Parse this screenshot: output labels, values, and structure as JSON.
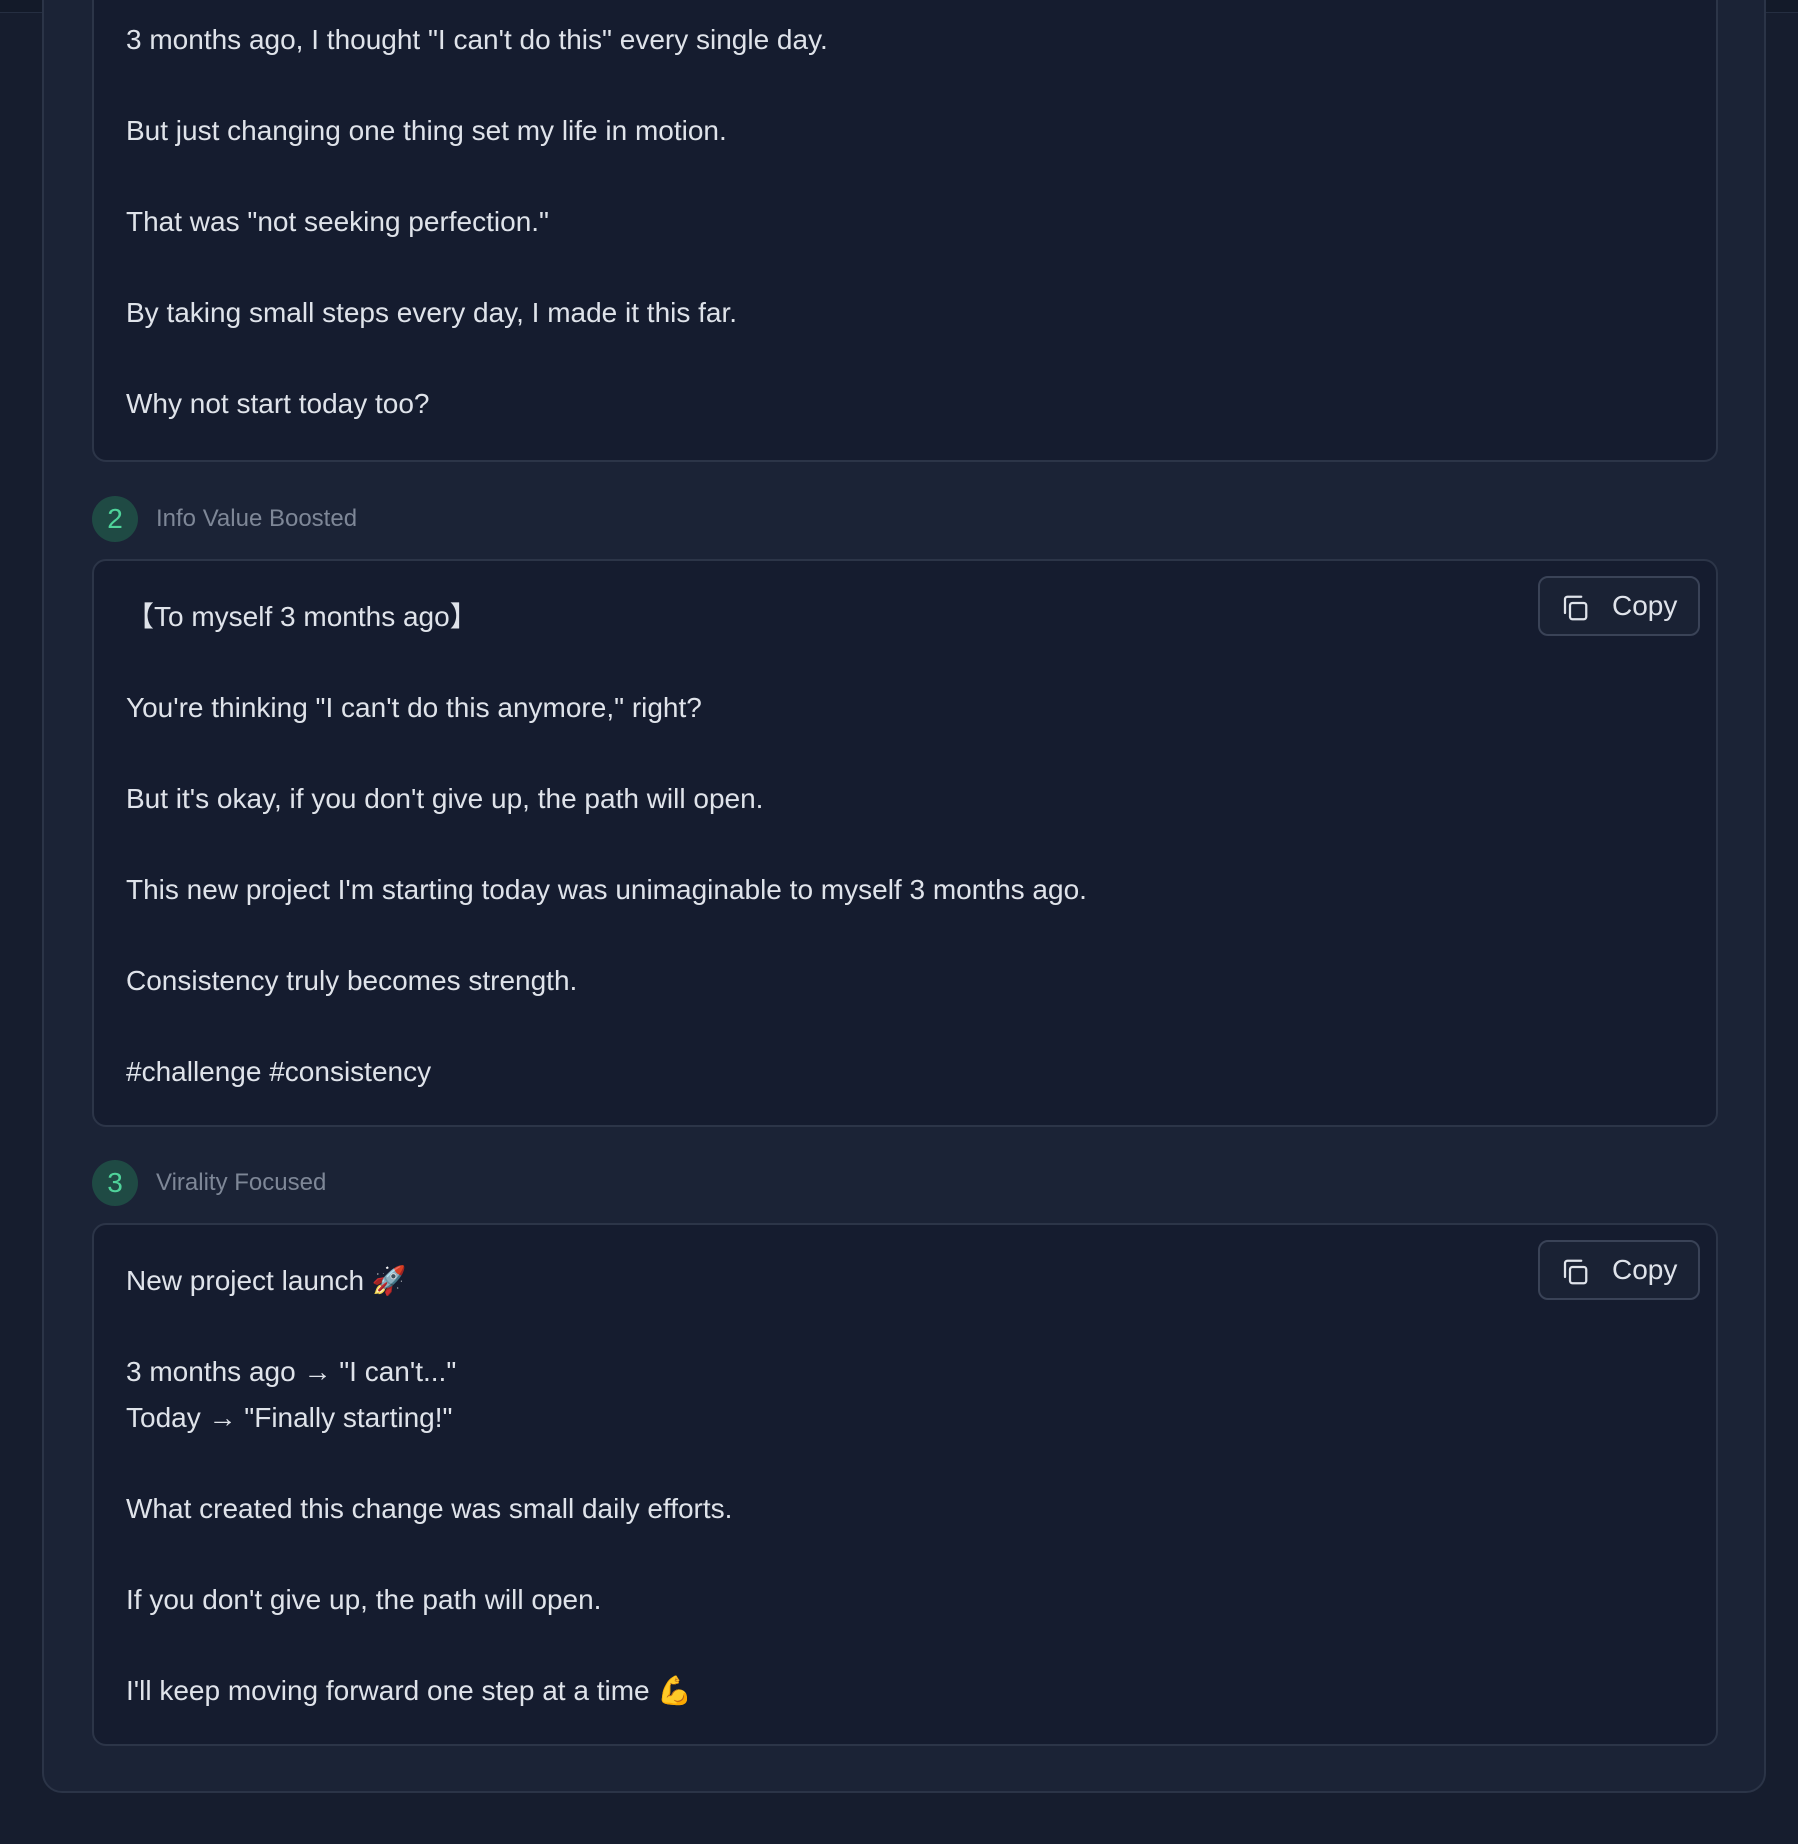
{
  "variants": [
    {
      "lines": [
        "3 months ago, I thought \"I can't do this\" every single day.",
        "But just changing one thing set my life in motion.",
        "That was \"not seeking perfection.\"",
        "By taking small steps every day, I made it this far.",
        "Why not start today too?"
      ]
    },
    {
      "number": "2",
      "label": "Info Value Boosted",
      "copy_label": "Copy",
      "lines": [
        "【To myself 3 months ago】",
        "You're thinking \"I can't do this anymore,\" right?",
        "But it's okay, if you don't give up, the path will open.",
        "This new project I'm starting today was unimaginable to myself 3 months ago.",
        "Consistency truly becomes strength.",
        "#challenge #consistency"
      ]
    },
    {
      "number": "3",
      "label": "Virality Focused",
      "copy_label": "Copy",
      "lines": [
        "New project launch 🚀",
        "3 months ago → \"I can't...\"",
        "Today → \"Finally starting!\"",
        "What created this change was small daily efforts.",
        "If you don't give up, the path will open.",
        "I'll keep moving forward one step at a time 💪"
      ]
    }
  ],
  "colors": {
    "page_background": "#161d2e",
    "panel_background": "#1b2336",
    "card_background": "#151c2f",
    "accent_green": "#4fd39a",
    "text_primary": "#dfe3ea",
    "text_muted": "#7e8797"
  },
  "icons": {
    "copy": "copy-icon"
  }
}
